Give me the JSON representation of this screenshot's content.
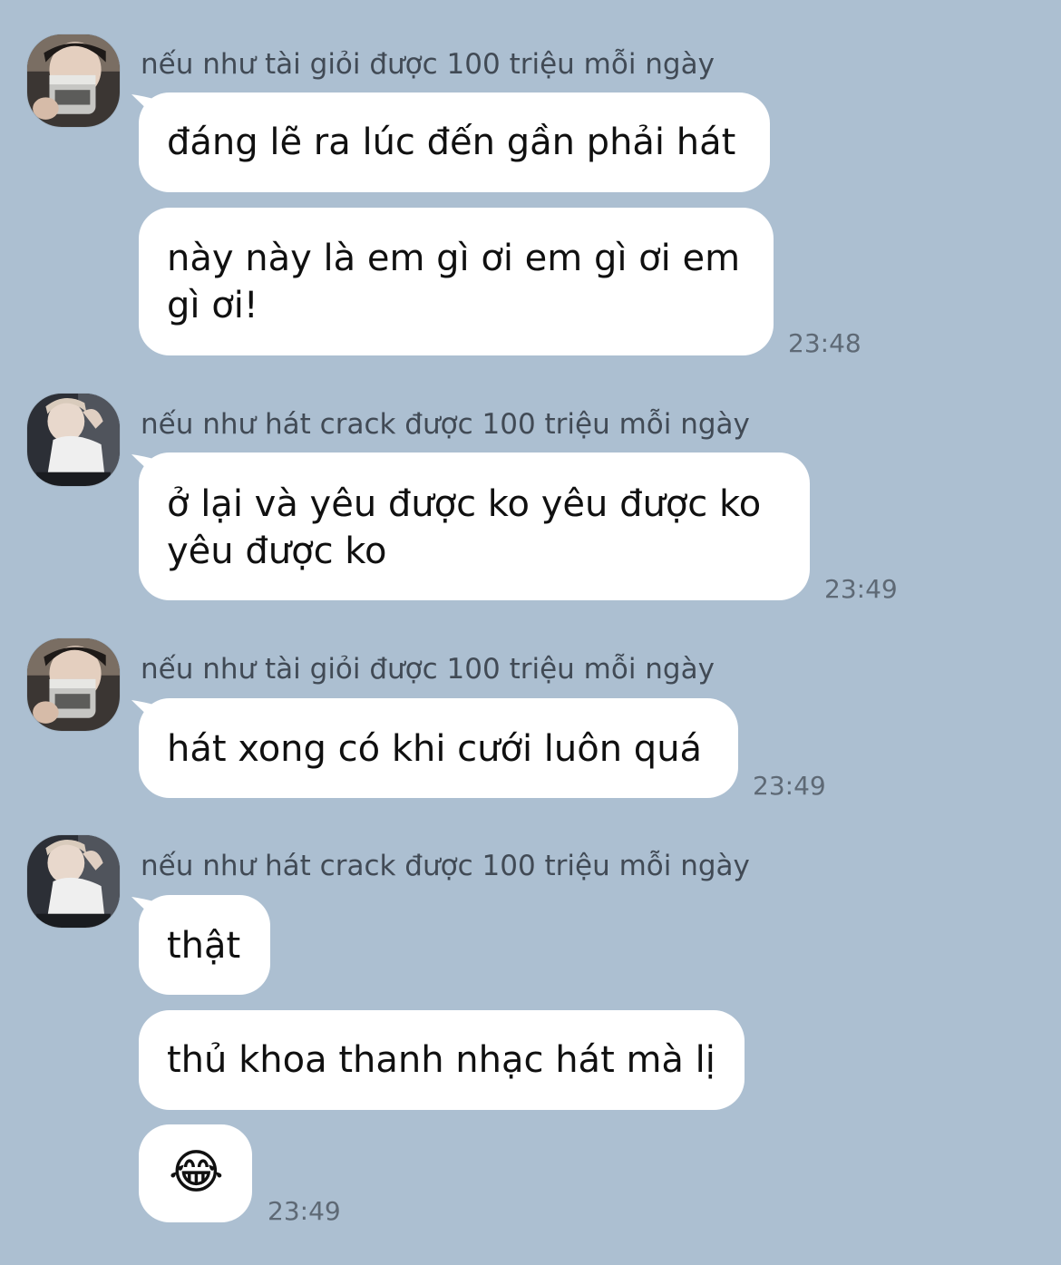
{
  "messages": [
    {
      "sender": "nếu như tài giỏi được 100 triệu mỗi ngày",
      "bubbles": [
        "đáng lẽ ra lúc đến gần phải hát",
        "này này là em gì ơi em gì ơi em",
        "gì ơi!"
      ],
      "time": "23:48"
    },
    {
      "sender": "nếu như hát crack được 100 triệu mỗi ngày",
      "bubbles": [
        "ở lại và yêu được ko yêu được ko",
        "yêu được ko"
      ],
      "time": "23:49"
    },
    {
      "sender": "nếu như tài giỏi được 100 triệu mỗi ngày",
      "bubbles": [
        "hát xong có khi cưới luôn quá"
      ],
      "time": "23:49"
    },
    {
      "sender": "nếu như hát crack được 100 triệu mỗi ngày",
      "bubbles": [
        "thật",
        "thủ khoa thanh nhạc hát mà lị",
        "😂"
      ],
      "time": "23:49"
    }
  ],
  "colors": {
    "background": "#acbfd1",
    "bubble": "#ffffff",
    "sender_text": "#414a55",
    "time_text": "#5e6975"
  }
}
